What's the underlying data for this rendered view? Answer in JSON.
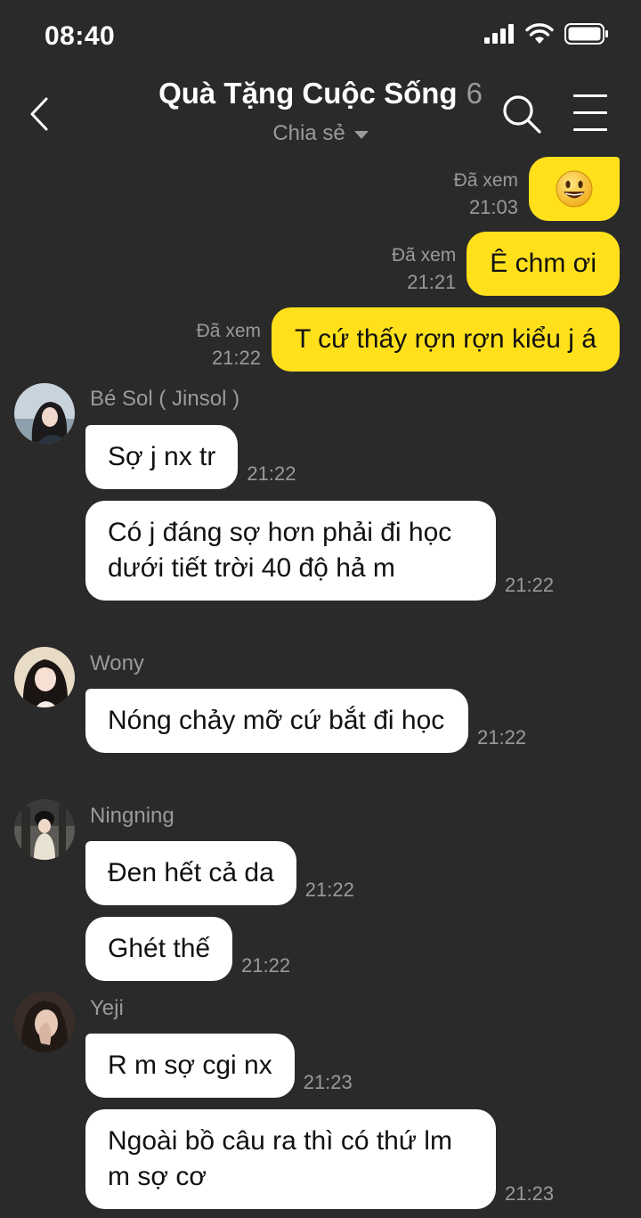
{
  "status_bar": {
    "time": "08:40"
  },
  "header": {
    "title": "Quà Tặng Cuộc Sống",
    "member_count": "6",
    "subtitle": "Chia sẻ"
  },
  "messages_out": [
    {
      "text": "😃",
      "status": "Đã xem",
      "time": "21:03"
    },
    {
      "text": "Ê chm ơi",
      "status": "Đã xem",
      "time": "21:21"
    },
    {
      "text": "T cứ thấy rợn rợn kiểu j á",
      "status": "Đã xem",
      "time": "21:22"
    }
  ],
  "groups": [
    {
      "sender": "Bé Sol ( Jinsol )",
      "messages": [
        {
          "text": "Sợ j nx tr",
          "time": "21:22"
        },
        {
          "text": "Có j đáng sợ hơn phải đi học dưới tiết trời 40 độ hả m",
          "time": "21:22"
        }
      ]
    },
    {
      "sender": "Wony",
      "messages": [
        {
          "text": "Nóng chảy mỡ cứ bắt đi học",
          "time": "21:22"
        }
      ]
    },
    {
      "sender": "Ningning",
      "messages": [
        {
          "text": "Đen hết cả da",
          "time": "21:22"
        },
        {
          "text": "Ghét thế",
          "time": "21:22"
        }
      ]
    },
    {
      "sender": "Yeji",
      "messages": [
        {
          "text": "R m sợ cgi nx",
          "time": "21:23"
        },
        {
          "text": "Ngoài bồ câu ra thì có thứ lm m sợ cơ",
          "time": "21:23"
        }
      ]
    }
  ],
  "colors": {
    "background": "#2a2a2a",
    "outgoing_bubble": "#ffe01b",
    "incoming_bubble": "#ffffff",
    "muted_text": "#9a9a9a"
  },
  "icons": [
    "signal-icon",
    "wifi-icon",
    "battery-icon",
    "back-arrow-icon",
    "search-icon",
    "menu-icon",
    "caret-down-icon"
  ]
}
